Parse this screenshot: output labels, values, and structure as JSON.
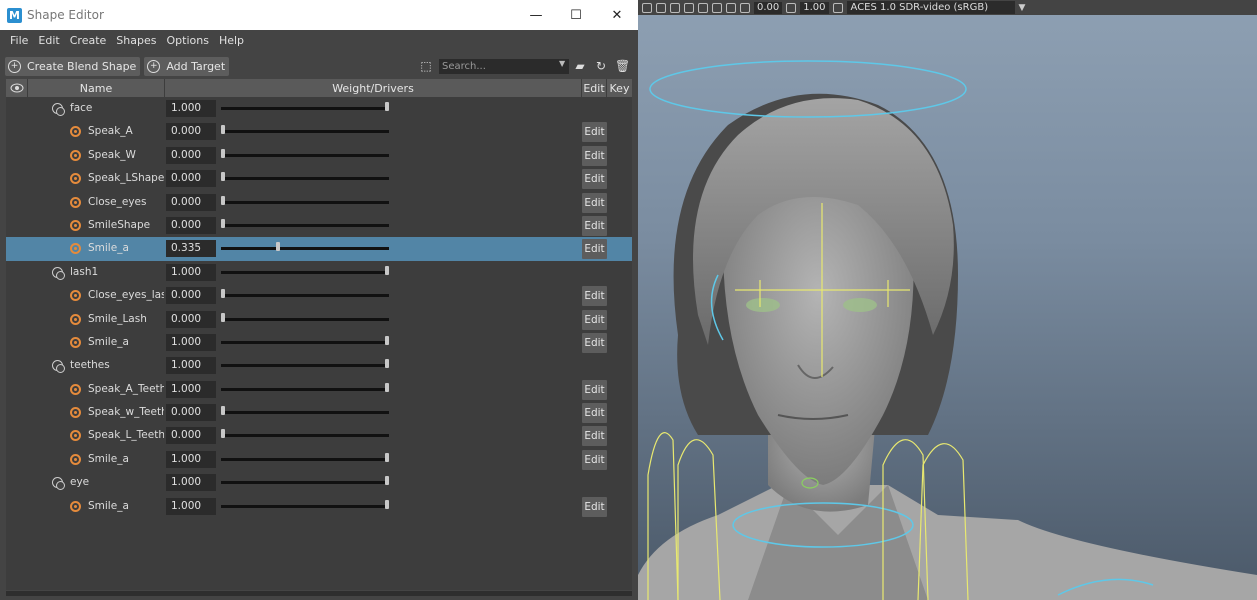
{
  "window": {
    "title": "Shape Editor",
    "app_icon_letter": "M",
    "minimize": "—",
    "maximize": "☐",
    "close": "✕"
  },
  "menu": [
    "File",
    "Edit",
    "Create",
    "Shapes",
    "Options",
    "Help"
  ],
  "toolbar": {
    "create_blend_shape": "Create Blend Shape",
    "add_target": "Add Target",
    "search_placeholder": "Search..."
  },
  "table": {
    "headers": {
      "name": "Name",
      "weight": "Weight/Drivers",
      "edit": "Edit",
      "key": "Key"
    },
    "edit_label": "Edit",
    "rows": [
      {
        "type": "blend",
        "name": "face",
        "value": "1.000",
        "weight": 1.0,
        "edit": false,
        "selected": false
      },
      {
        "type": "target",
        "name": "Speak_A",
        "value": "0.000",
        "weight": 0.0,
        "edit": true,
        "selected": false
      },
      {
        "type": "target",
        "name": "Speak_W",
        "value": "0.000",
        "weight": 0.0,
        "edit": true,
        "selected": false
      },
      {
        "type": "target",
        "name": "Speak_LShape",
        "value": "0.000",
        "weight": 0.0,
        "edit": true,
        "selected": false
      },
      {
        "type": "target",
        "name": "Close_eyes",
        "value": "0.000",
        "weight": 0.0,
        "edit": true,
        "selected": false
      },
      {
        "type": "target",
        "name": "SmileShape",
        "value": "0.000",
        "weight": 0.0,
        "edit": true,
        "selected": false
      },
      {
        "type": "target",
        "name": "Smile_a",
        "value": "0.335",
        "weight": 0.335,
        "edit": true,
        "selected": true
      },
      {
        "type": "blend",
        "name": "lash1",
        "value": "1.000",
        "weight": 1.0,
        "edit": false,
        "selected": false
      },
      {
        "type": "target",
        "name": "Close_eyes_lash",
        "value": "0.000",
        "weight": 0.0,
        "edit": true,
        "selected": false
      },
      {
        "type": "target",
        "name": "Smile_Lash",
        "value": "0.000",
        "weight": 0.0,
        "edit": true,
        "selected": false
      },
      {
        "type": "target",
        "name": "Smile_a",
        "value": "1.000",
        "weight": 1.0,
        "edit": true,
        "selected": false
      },
      {
        "type": "blend",
        "name": "teethes",
        "value": "1.000",
        "weight": 1.0,
        "edit": false,
        "selected": false
      },
      {
        "type": "target",
        "name": "Speak_A_Teeth",
        "value": "1.000",
        "weight": 1.0,
        "edit": true,
        "selected": false
      },
      {
        "type": "target",
        "name": "Speak_w_TeethS",
        "value": "0.000",
        "weight": 0.0,
        "edit": true,
        "selected": false
      },
      {
        "type": "target",
        "name": "Speak_L_TeethSl",
        "value": "0.000",
        "weight": 0.0,
        "edit": true,
        "selected": false
      },
      {
        "type": "target",
        "name": "Smile_a",
        "value": "1.000",
        "weight": 1.0,
        "edit": true,
        "selected": false
      },
      {
        "type": "blend",
        "name": "eye",
        "value": "1.000",
        "weight": 1.0,
        "edit": false,
        "selected": false
      },
      {
        "type": "target",
        "name": "Smile_a",
        "value": "1.000",
        "weight": 1.0,
        "edit": true,
        "selected": false
      }
    ]
  },
  "viewport": {
    "field_a": "0.00",
    "field_b": "1.00",
    "color_space": "ACES 1.0 SDR-video (sRGB)"
  },
  "colors": {
    "target_icon": "#e58b3c",
    "selection": "#5285a6",
    "halo": "#5ec8e8",
    "controls": "#e8e870"
  }
}
